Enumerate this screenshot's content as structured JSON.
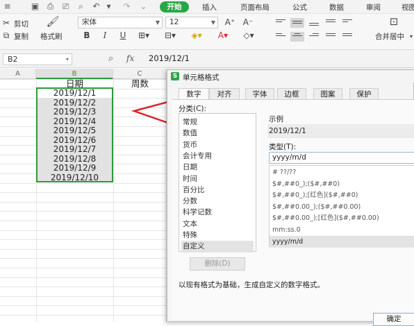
{
  "menubar": {
    "tabs": [
      "开始",
      "插入",
      "页面布局",
      "公式",
      "数据",
      "审阅",
      "视图"
    ]
  },
  "ribbon": {
    "cut": "剪切",
    "copy": "复制",
    "format_painter": "格式刷",
    "font_name": "宋体",
    "font_size": "12",
    "font_size_up": "A⁺",
    "font_size_down": "A⁻",
    "bold": "B",
    "italic": "I",
    "underline": "U",
    "merge_center": "合并居中"
  },
  "formula_bar": {
    "name_box": "B2",
    "fx_label": "fx",
    "value": "2019/12/1"
  },
  "grid": {
    "col_headers": [
      "A",
      "B",
      "C"
    ],
    "header_b": "日期",
    "header_c": "周数",
    "dates": [
      "2019/12/1",
      "2019/12/2",
      "2019/12/3",
      "2019/12/4",
      "2019/12/5",
      "2019/12/6",
      "2019/12/7",
      "2019/12/8",
      "2019/12/9",
      "2019/12/10"
    ]
  },
  "dialog": {
    "title": "单元格格式",
    "tabs": [
      "数字",
      "对齐",
      "字体",
      "边框",
      "图案",
      "保护"
    ],
    "category_label": "分类(C):",
    "categories": [
      "常规",
      "数值",
      "货币",
      "会计专用",
      "日期",
      "时间",
      "百分比",
      "分数",
      "科学记数",
      "文本",
      "特殊",
      "自定义"
    ],
    "selected_category": "自定义",
    "sample_label": "示例",
    "sample_value": "2019/12/1",
    "type_label": "类型(T):",
    "type_value": "yyyy/m/d",
    "formats": [
      "# ??/??",
      "$#,##0_);($#,##0)",
      "$#,##0_);[红色]($#,##0)",
      "$#,##0.00_);($#,##0.00)",
      "$#,##0.00_);[红色]($#,##0.00)",
      "mm:ss.0",
      "yyyy/m/d"
    ],
    "delete_button": "删除(D)",
    "description": "以现有格式为基础，生成自定义的数字格式。",
    "ok_button": "确定"
  },
  "colors": {
    "accent_green": "#27a844",
    "selection_border": "#2e9a3c",
    "arrow_red": "#d9262a"
  }
}
